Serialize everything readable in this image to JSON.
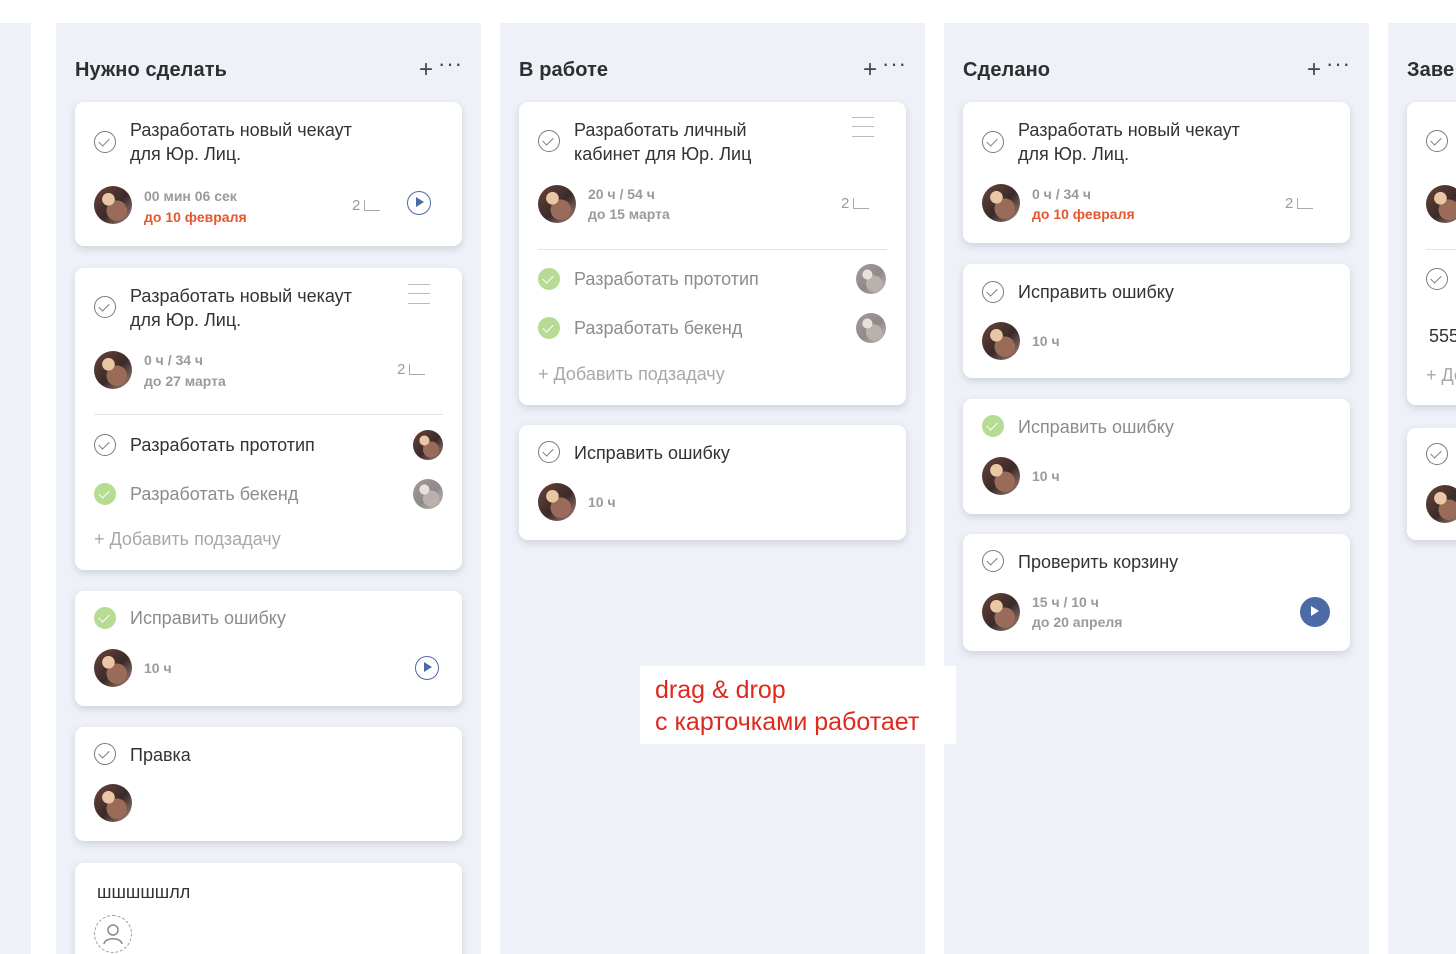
{
  "columns": [
    {
      "title": "Нужно сделать",
      "plus": "+",
      "more": "···",
      "cards": [
        {
          "title_line1": "Разработать новый чекаут",
          "title_line2": "для Юр. Лиц.",
          "meta1": "00 мин 06 сек",
          "meta2": "до 10 февраля",
          "subcount": "2"
        },
        {
          "title_line1": "Разработать новый чекаут",
          "title_line2": "для Юр. Лиц.",
          "meta1": "0 ч / 34 ч",
          "meta2": "до 27 марта",
          "subcount": "2",
          "subtasks": [
            "Разработать прототип",
            "Разработать бекенд"
          ],
          "add_subtask": "+ Добавить подзадачу"
        },
        {
          "title": "Исправить ошибку",
          "meta1": "10 ч"
        },
        {
          "title": "Правка"
        },
        {
          "title": "шшшшшлл"
        }
      ]
    },
    {
      "title": "В работе",
      "plus": "+",
      "more": "···",
      "cards": [
        {
          "title_line1": "Разработать личный",
          "title_line2": "кабинет для Юр. Лиц",
          "meta1": "20 ч / 54 ч",
          "meta2": "до 15 марта",
          "subcount": "2",
          "subtasks": [
            "Разработать прототип",
            "Разработать бекенд"
          ],
          "add_subtask": "+ Добавить подзадачу"
        },
        {
          "title": "Исправить ошибку",
          "meta1": "10 ч"
        }
      ]
    },
    {
      "title": "Сделано",
      "plus": "+",
      "more": "···",
      "cards": [
        {
          "title_line1": "Разработать новый чекаут",
          "title_line2": "для Юр. Лиц.",
          "meta1": "0 ч / 34 ч",
          "meta2": "до 10 февраля",
          "subcount": "2"
        },
        {
          "title": "Исправить ошибку",
          "meta1": "10 ч"
        },
        {
          "title": "Исправить ошибку",
          "meta1": "10 ч"
        },
        {
          "title": "Проверить корзину",
          "meta1": "15 ч / 10 ч",
          "meta2": "до 20 апреля"
        }
      ]
    },
    {
      "title": "Заве",
      "fragments": {
        "text1": "555",
        "text2": "+ До"
      }
    }
  ],
  "note": {
    "line1": "drag & drop",
    "line2": "с карточками работает"
  },
  "colors": {
    "accent": "#4c6aa6",
    "due_red": "#e4572e",
    "done_green": "#b6dc94",
    "column_bg": "#eef1f7"
  },
  "icons": [
    "check-circle-icon",
    "play-icon",
    "subtasks-icon",
    "drag-handle-icon",
    "plus-icon",
    "more-icon",
    "user-placeholder-icon"
  ]
}
